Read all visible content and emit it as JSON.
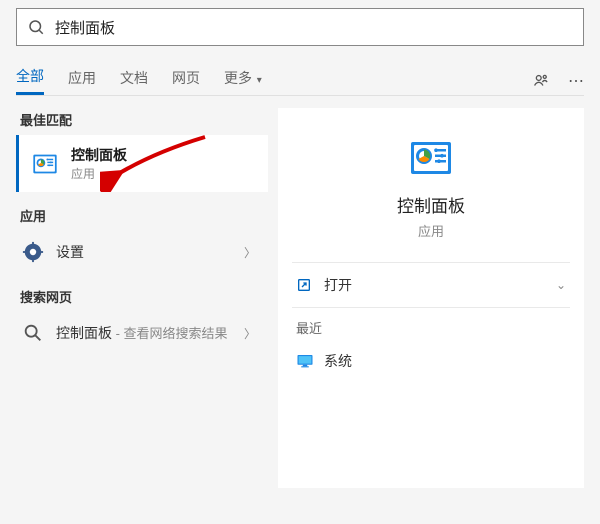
{
  "search": {
    "value": "控制面板"
  },
  "tabs": {
    "all": "全部",
    "apps": "应用",
    "docs": "文档",
    "web": "网页",
    "more": "更多"
  },
  "sections": {
    "best_match": "最佳匹配",
    "apps": "应用",
    "web_search": "搜索网页"
  },
  "best_match_item": {
    "title": "控制面板",
    "subtitle": "应用"
  },
  "app_item": {
    "label": "设置"
  },
  "web_item": {
    "label": "控制面板",
    "suffix": " - 查看网络搜索结果"
  },
  "detail": {
    "title": "控制面板",
    "subtitle": "应用",
    "open": "打开",
    "recent_label": "最近",
    "recent_item": "系统"
  }
}
